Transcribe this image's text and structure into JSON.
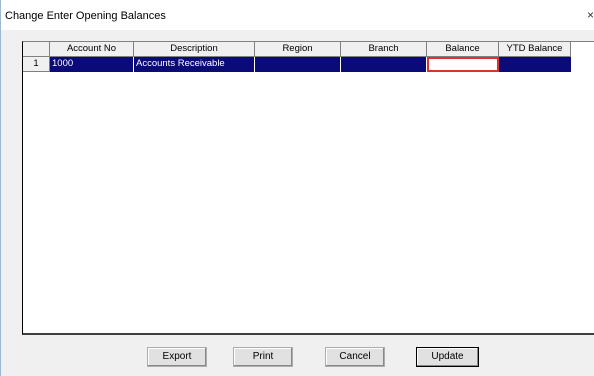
{
  "window": {
    "title": "Change Enter Opening Balances",
    "close_glyph": "×"
  },
  "grid": {
    "columns": [
      "Account No",
      "Description",
      "Region",
      "Branch",
      "Balance",
      "YTD Balance"
    ],
    "rows": [
      {
        "row_number": "1",
        "account_no": "1000",
        "description": "Accounts Receivable",
        "region": "",
        "branch": "",
        "balance": "",
        "ytd_balance": ""
      }
    ],
    "selection_color": "#0a0a78",
    "edit_border_color": "#e03030"
  },
  "buttons": {
    "export": "Export",
    "print": "Print",
    "cancel": "Cancel",
    "update": "Update"
  }
}
